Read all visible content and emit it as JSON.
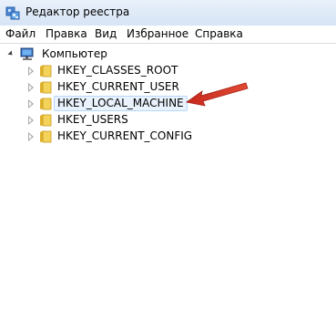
{
  "window": {
    "title": "Редактор реестра"
  },
  "menu": {
    "items": [
      "Файл",
      "Правка",
      "Вид",
      "Избранное",
      "Справка"
    ]
  },
  "tree": {
    "root": {
      "label": "Компьютер",
      "icon": "computer-icon",
      "expanded": true
    },
    "children": [
      {
        "label": "HKEY_CLASSES_ROOT",
        "icon": "folder-icon",
        "selected": false
      },
      {
        "label": "HKEY_CURRENT_USER",
        "icon": "folder-icon",
        "selected": false
      },
      {
        "label": "HKEY_LOCAL_MACHINE",
        "icon": "folder-icon",
        "selected": true
      },
      {
        "label": "HKEY_USERS",
        "icon": "folder-icon",
        "selected": false
      },
      {
        "label": "HKEY_CURRENT_CONFIG",
        "icon": "folder-icon",
        "selected": false
      }
    ]
  },
  "annotation": {
    "icon": "red-arrow-icon",
    "color": "#d93a2a"
  },
  "colors": {
    "folder": "#f0c93e",
    "selection_bg": "#eaf3fd",
    "selection_border": "#b8d6fb"
  }
}
